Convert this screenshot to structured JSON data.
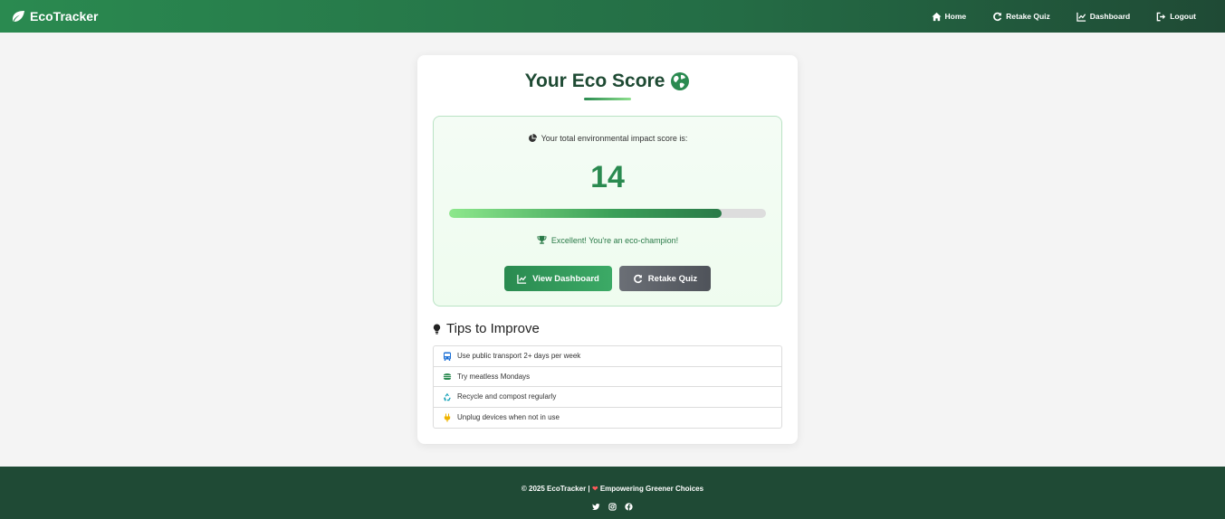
{
  "navbar": {
    "brand": "EcoTracker",
    "links": [
      {
        "label": "Home",
        "icon": "home-icon"
      },
      {
        "label": "Retake Quiz",
        "icon": "redo-icon"
      },
      {
        "label": "Dashboard",
        "icon": "chart-line-icon"
      },
      {
        "label": "Logout",
        "icon": "logout-icon"
      }
    ]
  },
  "card": {
    "title": "Your Eco Score",
    "score_label": "Your total environmental impact score is:",
    "score": "14",
    "progress_fraction": 0.86,
    "feedback": "Excellent! You're an eco-champion!",
    "buttons": {
      "dashboard": "View Dashboard",
      "retake": "Retake Quiz"
    },
    "tips_heading": "Tips to Improve",
    "tips": [
      {
        "text": "Use public transport 2+ days per week",
        "icon": "bus-icon",
        "color": "#1a6fd6"
      },
      {
        "text": "Try meatless Mondays",
        "icon": "burger-icon",
        "color": "#2a8a50"
      },
      {
        "text": "Recycle and compost regularly",
        "icon": "recycle-icon",
        "color": "#17a2b8"
      },
      {
        "text": "Unplug devices when not in use",
        "icon": "plug-icon",
        "color": "#f0b400"
      }
    ]
  },
  "footer": {
    "copyright": "© 2025 EcoTracker |",
    "tagline": "Empowering Greener Choices",
    "socials": [
      "twitter-icon",
      "instagram-icon",
      "facebook-icon"
    ]
  },
  "colors": {
    "brand_green": "#2a8a50",
    "dark_green": "#1f4a35",
    "score_border": "#b9e3c4"
  }
}
